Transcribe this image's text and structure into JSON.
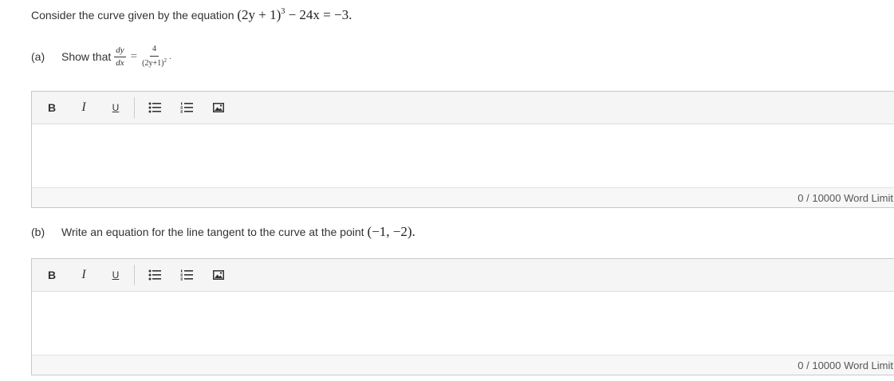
{
  "question": {
    "stem_text": "Consider the curve given by the equation",
    "stem_math_base": "(2y + 1)",
    "stem_math_exp": "3",
    "stem_math_rest": "− 24x = −3.",
    "parts": [
      {
        "label": "(a)",
        "text": "Show that",
        "math": {
          "lhs_num": "dy",
          "lhs_den": "dx",
          "eq": "=",
          "rhs_num": "4",
          "rhs_den_base": "(2y+1)",
          "rhs_den_exp": "2",
          "trailing": "."
        }
      },
      {
        "label": "(b)",
        "text": "Write an equation for the line tangent to the curve at the point",
        "math": "(−1, −2).",
        "point": "(−1, −2)."
      }
    ]
  },
  "editor": {
    "toolbar": {
      "bold": "B",
      "italic": "I",
      "underline": "U"
    },
    "word_limit_text": "0 / 10000 Word Limit"
  },
  "colors": {
    "toolbar_bg": "#f5f5f5",
    "border": "#c8c8c8"
  }
}
